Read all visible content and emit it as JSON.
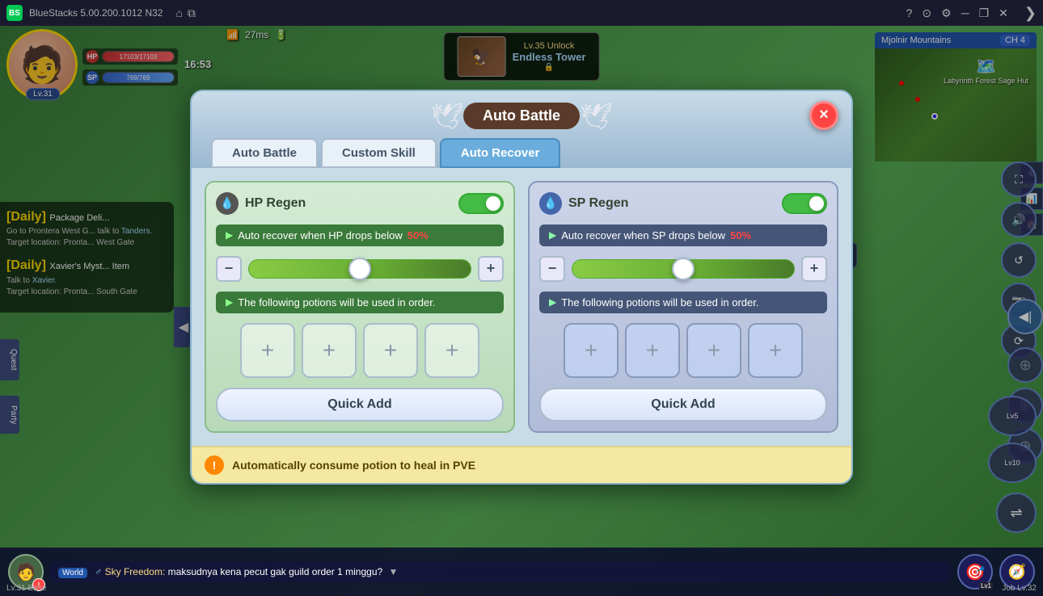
{
  "app": {
    "name": "BlueStacks",
    "version": "5.00.200.1012 N32",
    "icon": "BS"
  },
  "titlebar": {
    "title": "BlueStacks 5.00.200.1012 N32"
  },
  "player": {
    "level": "Lv.31",
    "hp_current": "17103",
    "hp_max": "17103",
    "sp_current": "769",
    "sp_max": "769",
    "hp_pct": 100,
    "sp_pct": 100,
    "time": "16:53",
    "ping": "27ms"
  },
  "map": {
    "name": "Mjolnir Mountains",
    "channel": "CH 4",
    "location": "Labyrinth Forest Sage Hut"
  },
  "dungeon": {
    "unlock_level": "Lv.35 Unlock",
    "name": "Endless Tower"
  },
  "dialog": {
    "title": "Auto Battle",
    "close_label": "×",
    "tabs": [
      {
        "id": "auto-battle",
        "label": "Auto Battle",
        "active": false
      },
      {
        "id": "custom-skill",
        "label": "Custom Skill",
        "active": false
      },
      {
        "id": "auto-recover",
        "label": "Auto Recover",
        "active": true
      }
    ]
  },
  "hp_panel": {
    "title": "HP Regen",
    "toggle_on": true,
    "auto_recover_text": "Auto recover when HP drops below",
    "threshold_pct": "50%",
    "slider_pct": 50,
    "potions_text": "The following potions will be used in order.",
    "potions": [
      "+",
      "+",
      "+",
      "+"
    ],
    "quick_add_label": "Quick Add"
  },
  "sp_panel": {
    "title": "SP Regen",
    "toggle_on": true,
    "auto_recover_text": "Auto recover when SP drops below",
    "threshold_pct": "50%",
    "slider_pct": 50,
    "potions_text": "The following potions will be used in order.",
    "potions": [
      "+",
      "+",
      "+",
      "+"
    ],
    "quick_add_label": "Quick Add"
  },
  "footer": {
    "icon": "!",
    "text": "Automatically consume potion to heal in PVE"
  },
  "chat": {
    "channel": "World",
    "gender": "♂",
    "player": "Sky Freedom:",
    "message": "maksudnya kena pecut gak guild order 1 minggu?"
  },
  "quests": [
    {
      "type": "[Daily]",
      "title": "Package Deli...",
      "desc": "Go to Prontera West G... talk to Tanders.",
      "location": "Target location: Pronta... West Gate"
    },
    {
      "type": "[Daily]",
      "title": "Xavier's Myst... Item",
      "desc": "Talk to Xavier.",
      "location": "Target location: Pronta... South Gate"
    }
  ],
  "bottom_bar": {
    "level": "Lv.31 Base",
    "job_level": "Job Lv.32"
  }
}
